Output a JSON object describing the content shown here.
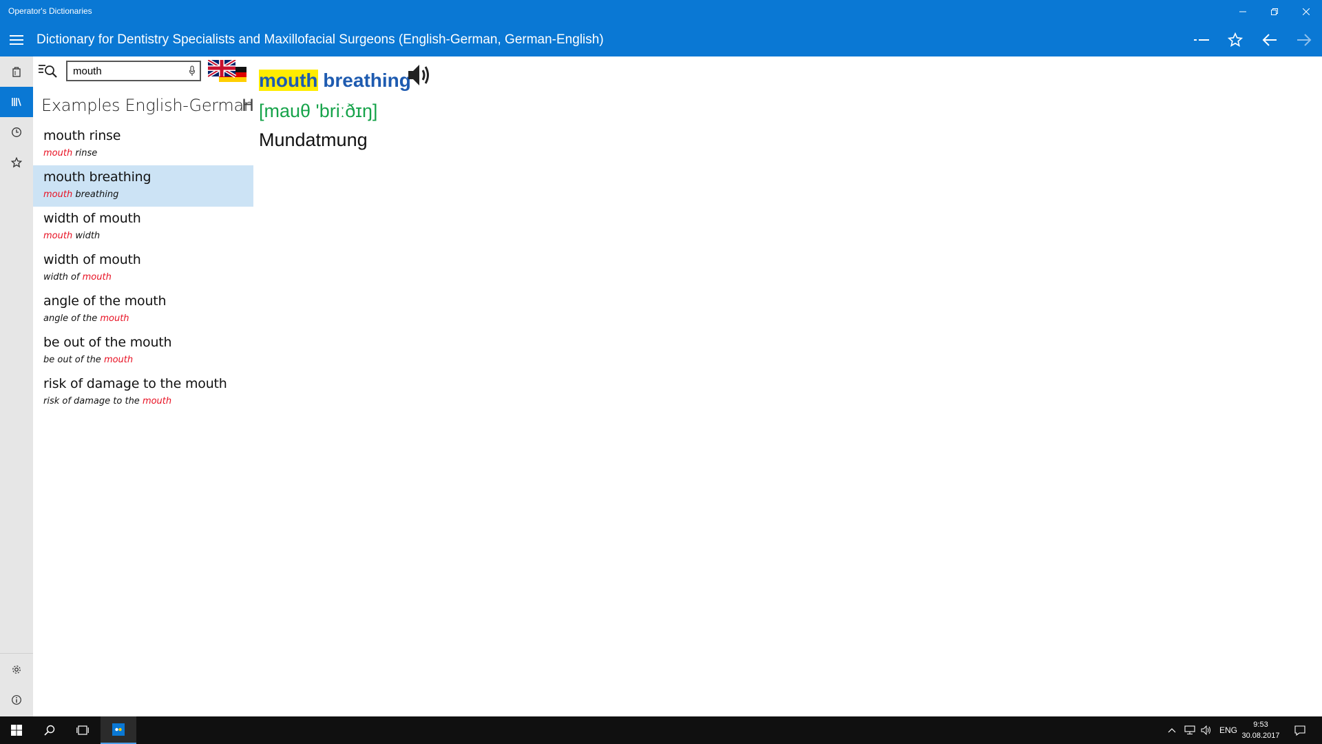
{
  "window": {
    "title": "Operator's Dictionaries"
  },
  "header": {
    "dictionary_title": "Dictionary for Dentistry Specialists and Maxillofacial Surgeons (English-German, German-English)"
  },
  "search": {
    "value": "mouth"
  },
  "list": {
    "header": "Examples English-German",
    "header_cut": "H",
    "items": [
      {
        "main": "mouth rinse",
        "sub_pre": "",
        "sub_hl": "mouth",
        "sub_post": " rinse",
        "selected": false
      },
      {
        "main": "mouth breathing",
        "sub_pre": "",
        "sub_hl": "mouth",
        "sub_post": " breathing",
        "selected": true
      },
      {
        "main": "width of mouth",
        "sub_pre": "",
        "sub_hl": "mouth",
        "sub_post": " width",
        "selected": false
      },
      {
        "main": "width of mouth",
        "sub_pre": "width of ",
        "sub_hl": "mouth",
        "sub_post": "",
        "selected": false
      },
      {
        "main": "angle of the mouth",
        "sub_pre": "angle of the ",
        "sub_hl": "mouth",
        "sub_post": "",
        "selected": false
      },
      {
        "main": "be out of the mouth",
        "sub_pre": "be out of the ",
        "sub_hl": "mouth",
        "sub_post": "",
        "selected": false
      },
      {
        "main": "risk of damage to the mouth",
        "sub_pre": "risk of damage to the ",
        "sub_hl": "mouth",
        "sub_post": "",
        "selected": false
      }
    ]
  },
  "entry": {
    "headword_highlight": "mouth",
    "headword_rest": " breathing",
    "pronunciation": "[mauθ 'briːðɪŋ]",
    "translation": "Mundatmung"
  },
  "taskbar": {
    "language": "ENG",
    "time": "9:53",
    "date": "30.08.2017"
  },
  "colors": {
    "accent": "#0a78d4",
    "selected_row": "#cce3f5",
    "headword": "#1e5bb0",
    "highlight": "#ffec00",
    "pronunciation": "#16a34a",
    "match": "#e81123"
  },
  "icons": {
    "sidebar": [
      "dictionaries-icon",
      "library-icon",
      "history-icon",
      "favorites-star-icon",
      "settings-gear-icon",
      "info-icon"
    ],
    "header": [
      "hamburger-icon",
      "collapse-icon",
      "star-icon",
      "back-arrow-icon",
      "forward-arrow-icon"
    ],
    "search": [
      "search-magnifier-icon",
      "microphone-icon",
      "uk-flag-icon",
      "german-flag-icon",
      "speaker-icon"
    ]
  }
}
